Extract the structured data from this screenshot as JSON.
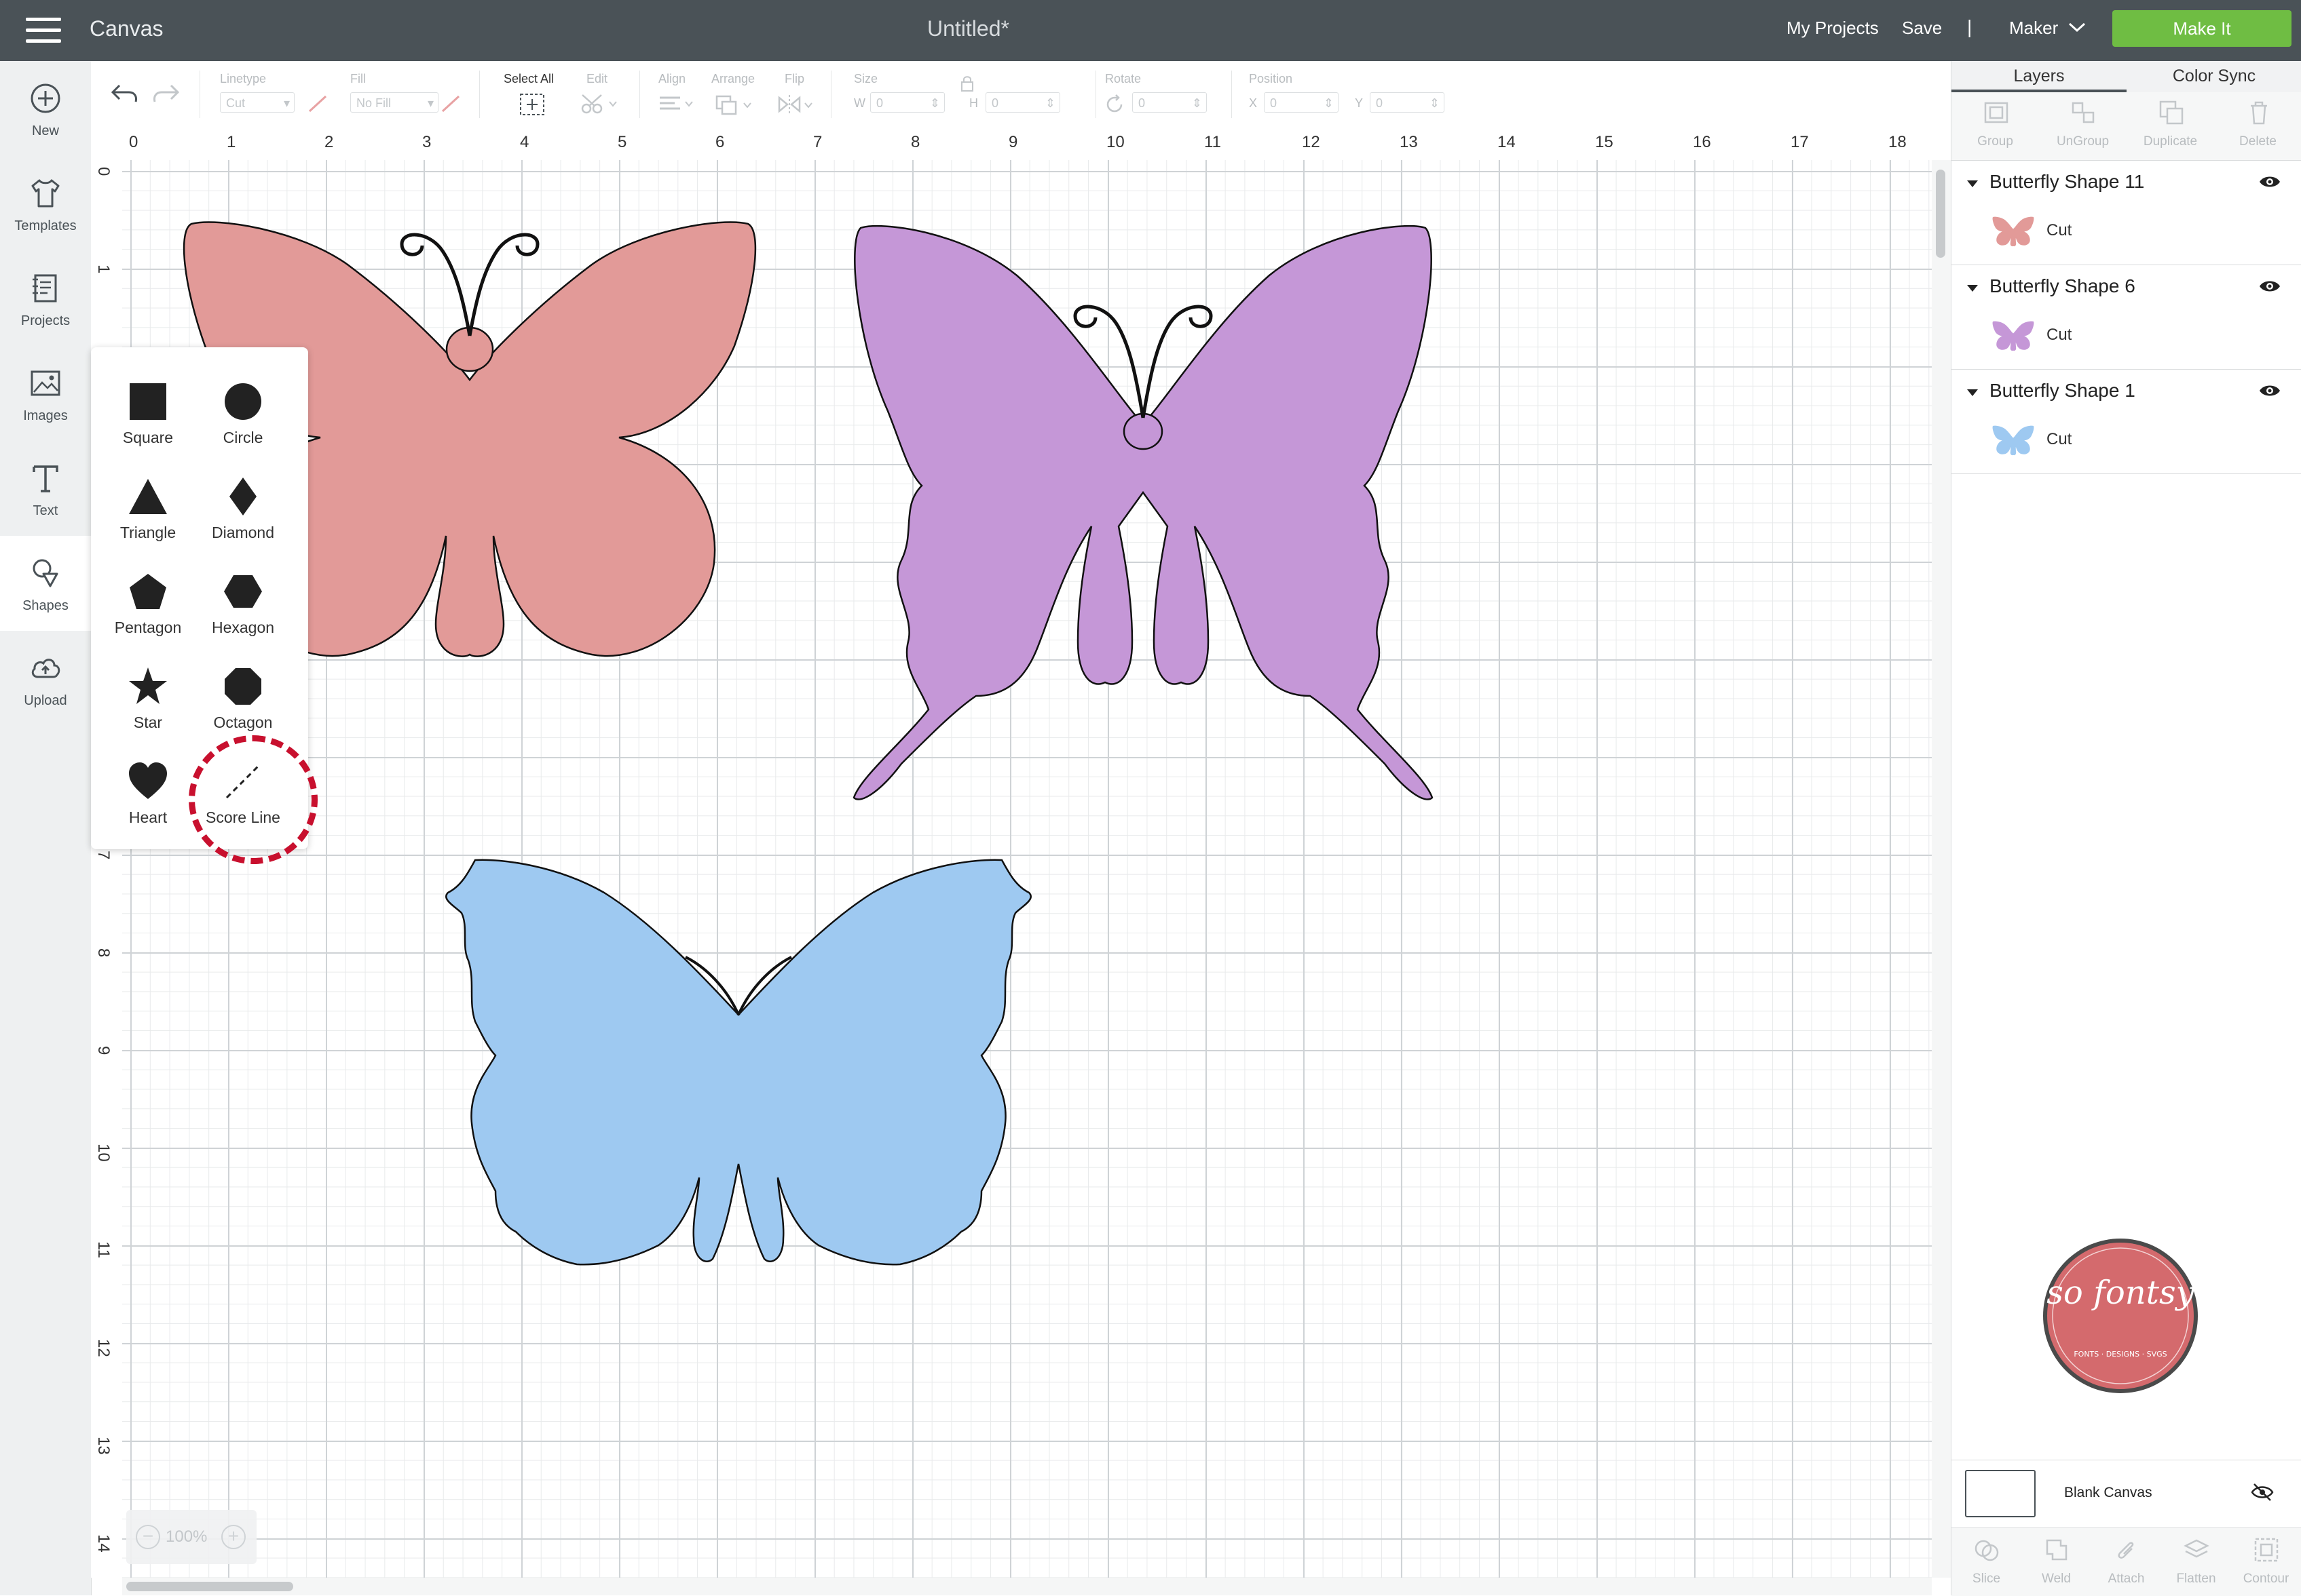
{
  "topbar": {
    "app_title": "Canvas",
    "document_title": "Untitled*",
    "my_projects": "My Projects",
    "save": "Save",
    "divider": "|",
    "machine": "Maker",
    "make_it": "Make It"
  },
  "leftnav": {
    "items": [
      {
        "label": "New",
        "icon": "plus-circle-icon"
      },
      {
        "label": "Templates",
        "icon": "tshirt-icon"
      },
      {
        "label": "Projects",
        "icon": "notebook-icon"
      },
      {
        "label": "Images",
        "icon": "image-icon"
      },
      {
        "label": "Text",
        "icon": "text-t-icon"
      },
      {
        "label": "Shapes",
        "icon": "shapes-icon",
        "active": true
      },
      {
        "label": "Upload",
        "icon": "cloud-upload-icon"
      }
    ]
  },
  "toolbar": {
    "linetype_label": "Linetype",
    "linetype_value": "Cut",
    "fill_label": "Fill",
    "fill_value": "No Fill",
    "select_all": "Select All",
    "edit": "Edit",
    "align": "Align",
    "arrange": "Arrange",
    "flip": "Flip",
    "size": "Size",
    "w_label": "W",
    "w_value": "0",
    "h_label": "H",
    "h_value": "0",
    "rotate": "Rotate",
    "rotate_value": "0",
    "position": "Position",
    "x_label": "X",
    "x_value": "0",
    "y_label": "Y",
    "y_value": "0"
  },
  "rulers": {
    "top": [
      "0",
      "1",
      "2",
      "3",
      "4",
      "5",
      "6",
      "7",
      "8",
      "9",
      "10",
      "11",
      "12",
      "13",
      "14",
      "15",
      "16",
      "17",
      "18"
    ],
    "left": [
      "0",
      "1",
      "7",
      "8",
      "9",
      "10",
      "11",
      "12",
      "13",
      "14"
    ]
  },
  "zoom": {
    "level": "100%"
  },
  "shapes_panel": {
    "shapes": [
      {
        "label": "Square",
        "icon": "square-icon"
      },
      {
        "label": "Circle",
        "icon": "circle-icon"
      },
      {
        "label": "Triangle",
        "icon": "triangle-icon"
      },
      {
        "label": "Diamond",
        "icon": "diamond-icon"
      },
      {
        "label": "Pentagon",
        "icon": "pentagon-icon"
      },
      {
        "label": "Hexagon",
        "icon": "hexagon-icon"
      },
      {
        "label": "Star",
        "icon": "star-icon"
      },
      {
        "label": "Octagon",
        "icon": "octagon-icon"
      },
      {
        "label": "Heart",
        "icon": "heart-icon"
      },
      {
        "label": "Score Line",
        "icon": "score-line-icon",
        "highlighted": true
      }
    ]
  },
  "canvas_objects": [
    {
      "name": "Butterfly Shape 11",
      "color": "#e29a98"
    },
    {
      "name": "Butterfly Shape 6",
      "color": "#c597d7"
    },
    {
      "name": "Butterfly Shape 1",
      "color": "#9ec9f1"
    }
  ],
  "rightpanel": {
    "tabs": [
      "Layers",
      "Color Sync"
    ],
    "actions": [
      "Group",
      "UnGroup",
      "Duplicate",
      "Delete"
    ],
    "layers": [
      {
        "name": "Butterfly Shape 11",
        "operation": "Cut",
        "color": "#e29a98"
      },
      {
        "name": "Butterfly Shape 6",
        "operation": "Cut",
        "color": "#c597d7"
      },
      {
        "name": "Butterfly Shape 1",
        "operation": "Cut",
        "color": "#9ec9f1"
      }
    ],
    "blank_canvas": "Blank Canvas",
    "bottom_actions": [
      "Slice",
      "Weld",
      "Attach",
      "Flatten",
      "Contour"
    ]
  },
  "watermark": {
    "brand": "so fontsy",
    "tagline": "FONTS · DESIGNS · SVGS",
    "color": "#d46a6d"
  },
  "colors": {
    "topbar": "#4a5257",
    "make_it": "#6fbd43",
    "highlight": "#c8102e"
  }
}
